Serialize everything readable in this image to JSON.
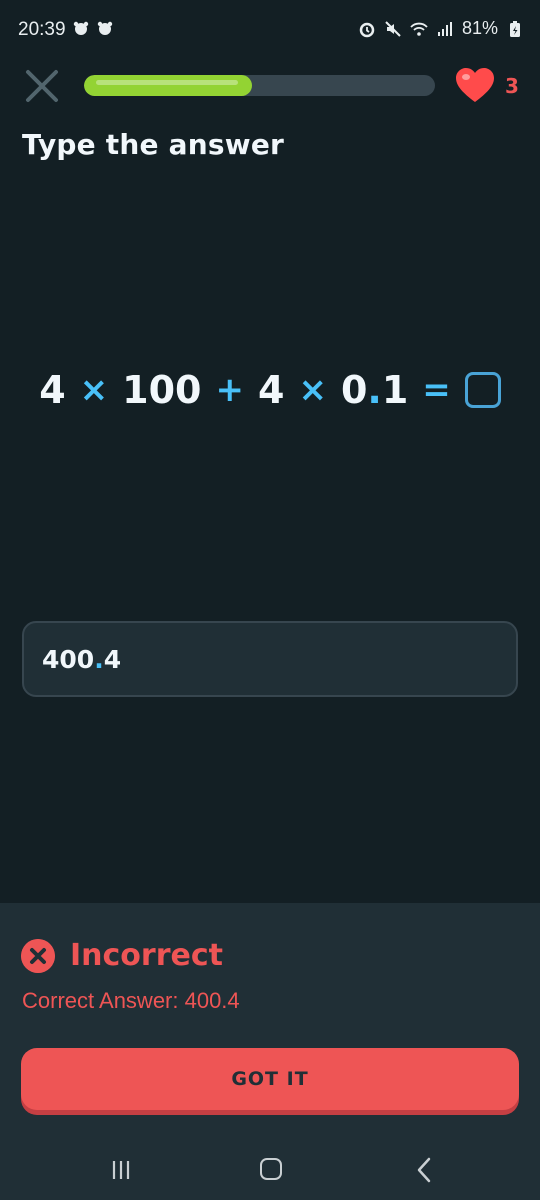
{
  "status_bar": {
    "time": "20:39",
    "battery_percent": "81%",
    "left_icons": [
      "notification-icon",
      "notification-icon"
    ],
    "right_icons": [
      "alarm-icon",
      "mute-icon",
      "wifi-icon",
      "signal-icon",
      "battery-icon"
    ]
  },
  "header": {
    "close_icon": "close-icon",
    "progress_fraction": 0.48,
    "hearts_count": "3",
    "accent_color": "#93d333"
  },
  "prompt": {
    "title": "Type the answer"
  },
  "equation": {
    "a": "4",
    "times_1": "×",
    "b": "100",
    "plus": "+",
    "c": "4",
    "times_2": "×",
    "d_int": "0",
    "d_dot": ".",
    "d_frac": "1",
    "equals": "="
  },
  "answer": {
    "value_int": "400",
    "value_dot": ".",
    "value_frac": "4"
  },
  "feedback": {
    "status": "Incorrect",
    "correct_answer_text": "Correct Answer: 400.4",
    "button_label": "GOT IT",
    "error_color": "#ee5555"
  },
  "nav": {
    "icons": [
      "recent-apps-icon",
      "home-icon",
      "back-icon"
    ]
  }
}
